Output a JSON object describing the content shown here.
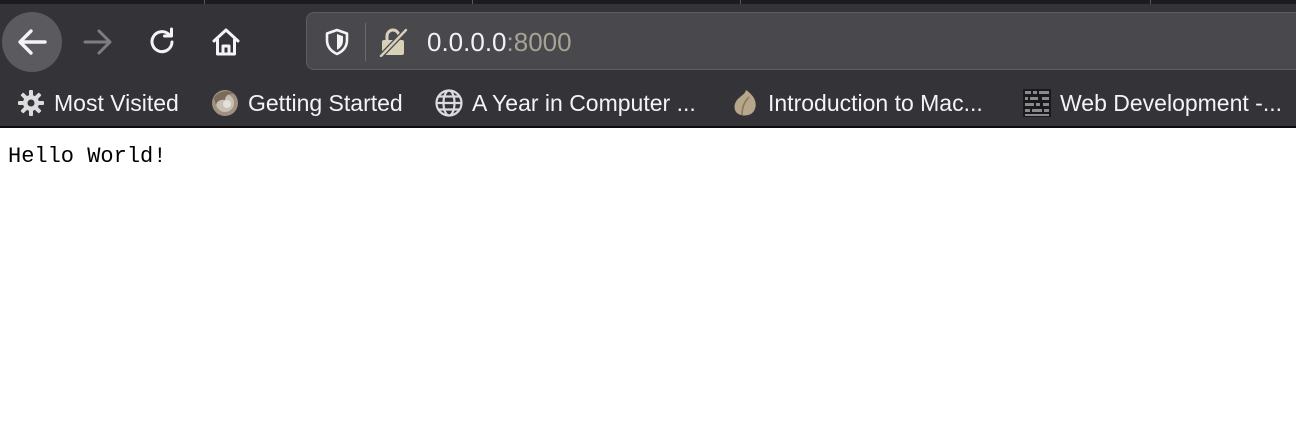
{
  "colors": {
    "chrome_bg": "#333338",
    "urlbar_bg": "#48484d",
    "url_text": "#f2f2f4",
    "url_port": "#a8a294",
    "page_bg": "#ffffff"
  },
  "toolbar": {
    "icons": [
      "back-arrow-icon",
      "forward-arrow-icon",
      "reload-icon",
      "home-icon"
    ]
  },
  "urlbar": {
    "host": "0.0.0.0",
    "port": ":8000",
    "icons": [
      "shield-icon",
      "insecure-lock-icon"
    ]
  },
  "bookmarks": [
    {
      "label": "Most Visited",
      "icon": "gear-icon"
    },
    {
      "label": "Getting Started",
      "icon": "firefox-icon"
    },
    {
      "label": "A Year in Computer ...",
      "icon": "globe-icon"
    },
    {
      "label": "Introduction to Mac...",
      "icon": "leaf-icon"
    },
    {
      "label": "Web Development -...",
      "icon": "grid-icon"
    }
  ],
  "page": {
    "body_text": "Hello World!"
  }
}
